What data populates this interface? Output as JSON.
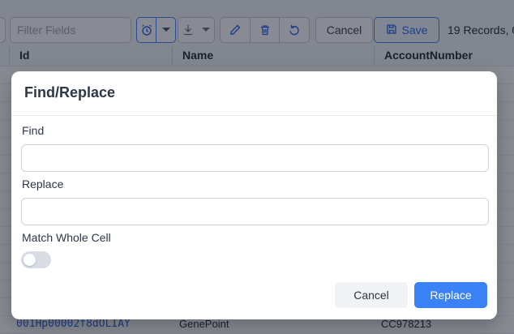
{
  "toolbar": {
    "filter_placeholder": "Filter Fields",
    "cancel_label": "Cancel",
    "save_label": "Save",
    "records_text": "19 Records, 0"
  },
  "grid": {
    "columns": [
      "Id",
      "Name",
      "AccountNumber"
    ],
    "visible_row": {
      "id": "001Hp00002f8dOLIAY",
      "name": "GenePoint",
      "account_number": "CC978213"
    }
  },
  "modal": {
    "title": "Find/Replace",
    "find_label": "Find",
    "find_value": "",
    "replace_label": "Replace",
    "replace_value": "",
    "match_whole_cell_label": "Match Whole Cell",
    "match_whole_cell_on": false,
    "cancel_label": "Cancel",
    "replace_button_label": "Replace"
  },
  "colors": {
    "accent": "#3b82f6",
    "overlay": "#111827",
    "toggle_off": "#d8dde5"
  },
  "icons": [
    "alarm-clock-icon",
    "chevron-down-icon",
    "download-icon",
    "pencil-icon",
    "trash-icon",
    "undo-icon",
    "save-icon"
  ]
}
